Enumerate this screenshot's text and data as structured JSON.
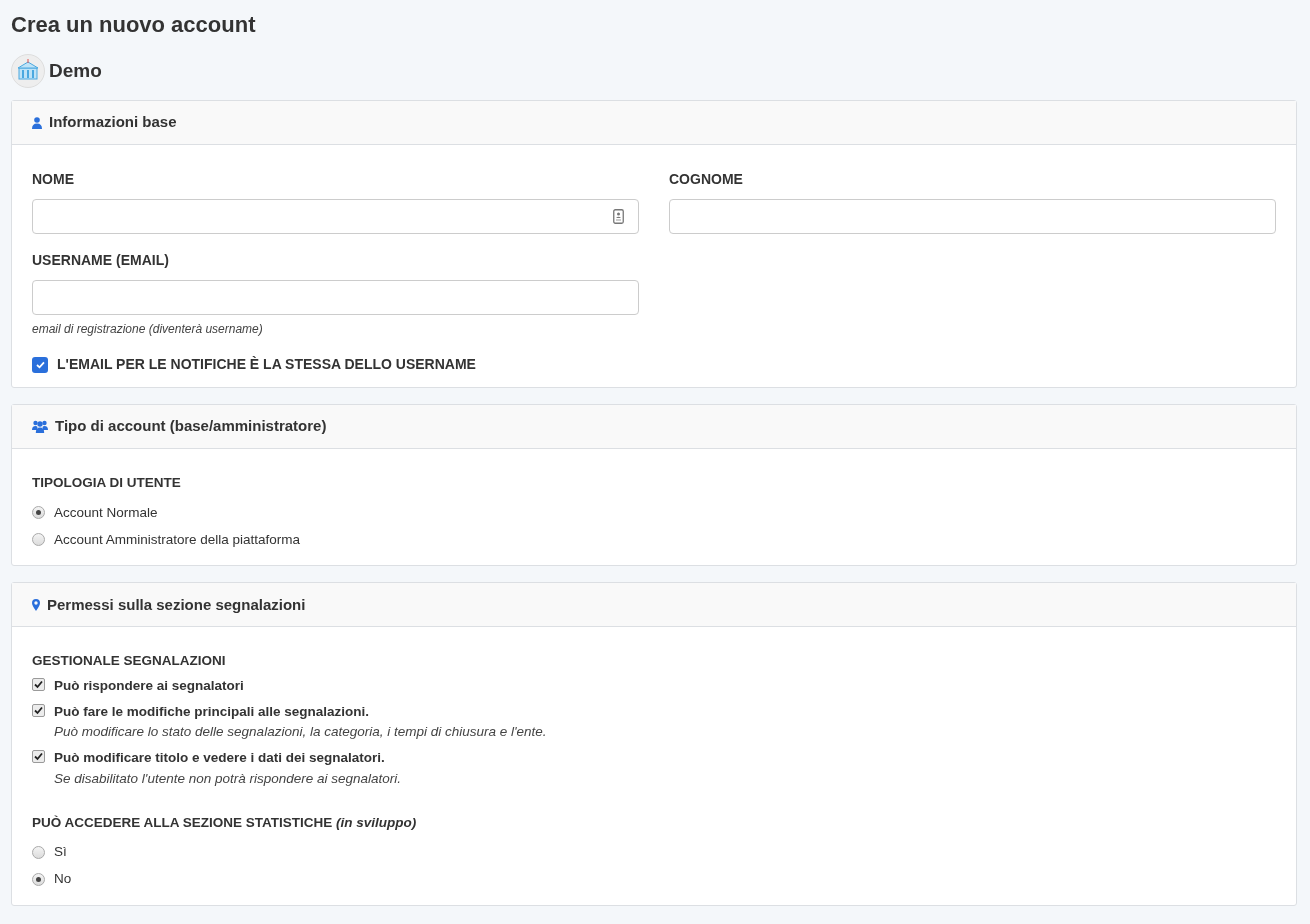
{
  "page_title": "Crea un nuovo account",
  "organization": {
    "name": "Demo"
  },
  "sections": [
    {
      "kind": "user",
      "title": "Informazioni base",
      "blocks": [
        {
          "kind": "fields",
          "fields": [
            {
              "label": "NOME",
              "autofill": true
            },
            {
              "label": "COGNOME",
              "autofill": false
            }
          ]
        },
        {
          "kind": "fields",
          "fields": [
            {
              "label": "USERNAME (EMAIL)",
              "autofill": false,
              "help": "email di registrazione (diventerà username)"
            }
          ]
        },
        {
          "kind": "toggle",
          "label": "L'EMAIL PER LE NOTIFICHE È LA STESSA DELLO USERNAME",
          "checked": true
        }
      ]
    },
    {
      "kind": "users",
      "title": "Tipo di account (base/amministratore)",
      "blocks": [
        {
          "kind": "radios",
          "label": "TIPOLOGIA DI UTENTE",
          "options": [
            {
              "label": "Account Normale",
              "selected": true
            },
            {
              "label": "Account Amministratore della piattaforma",
              "selected": false
            }
          ]
        }
      ]
    },
    {
      "kind": "pin",
      "title": "Permessi sulla sezione segnalazioni",
      "blocks": [
        {
          "kind": "checks",
          "label": "GESTIONALE SEGNALAZIONI",
          "items": [
            {
              "label": "Può rispondere ai segnalatori",
              "checked": true
            },
            {
              "label": "Può fare le modifiche principali alle segnalazioni.",
              "description": "Può modificare lo stato delle segnalazioni, la categoria, i tempi di chiusura e l'ente.",
              "checked": true
            },
            {
              "label": "Può modificare titolo e vedere i dati dei segnalatori.",
              "description": "Se disabilitato l'utente non potrà rispondere ai segnalatori.",
              "checked": true
            }
          ]
        },
        {
          "kind": "radios",
          "label": "PUÒ ACCEDERE ALLA SEZIONE STATISTICHE *(in sviluppo)*",
          "options": [
            {
              "label": "Sì",
              "selected": false
            },
            {
              "label": "No",
              "selected": true
            }
          ]
        }
      ]
    }
  ]
}
